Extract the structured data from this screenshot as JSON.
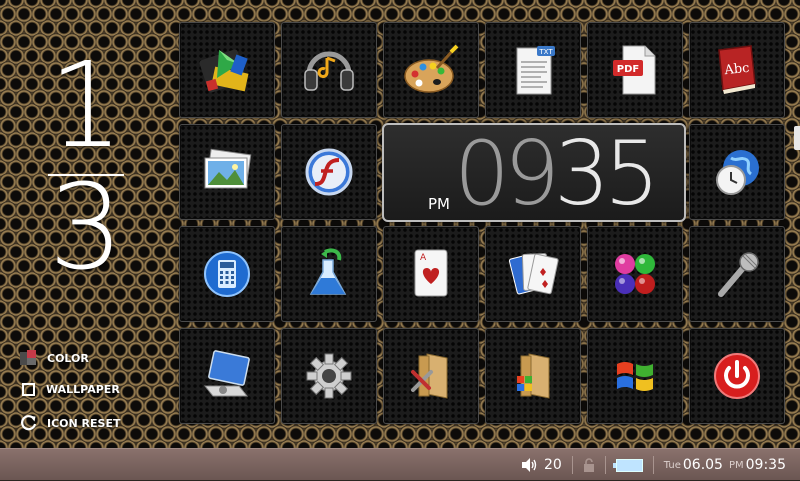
{
  "page_indicator": {
    "current": "1",
    "total": "3"
  },
  "left_menu": [
    {
      "label": "COLOR",
      "icon": "color-palette-icon"
    },
    {
      "label": "WALLPAPER",
      "icon": "wallpaper-icon"
    },
    {
      "label": "ICON RESET",
      "icon": "refresh-icon"
    }
  ],
  "clock": {
    "ampm": "PM",
    "hours": "09",
    "minutes": "35"
  },
  "apps": [
    "media-player",
    "music-headphones",
    "paint",
    "text-viewer",
    "pdf-viewer",
    "dictionary",
    "photo-viewer",
    "flash-player",
    "world-clock",
    "calculator",
    "science-flask",
    "solitaire-ace",
    "card-game",
    "ball-game",
    "microphone",
    "system-properties",
    "settings-gear",
    "tools-folder",
    "windows-folder",
    "windows-logo",
    "power"
  ],
  "taskbar": {
    "volume": "20",
    "day": "Tue",
    "date": "06.05",
    "ampm": "PM",
    "time": "09:35"
  },
  "colors": {
    "taskbar": "#7b6461",
    "accent_red": "#c53a48",
    "battery": "#bfe4ff"
  }
}
